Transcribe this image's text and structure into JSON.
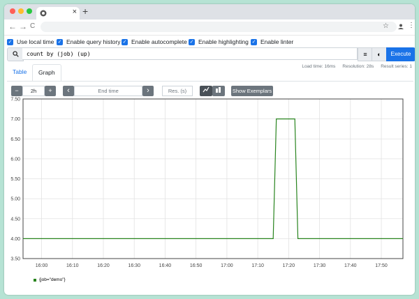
{
  "browser": {
    "tab_close": "×",
    "new_tab": "+",
    "back": "←",
    "forward": "→",
    "reload": "C",
    "star_icon": "☆",
    "menu_icon": "⋮"
  },
  "options": [
    {
      "label": "Use local time",
      "checked": true
    },
    {
      "label": "Enable query history",
      "checked": true
    },
    {
      "label": "Enable autocomplete",
      "checked": true
    },
    {
      "label": "Enable highlighting",
      "checked": true
    },
    {
      "label": "Enable linter",
      "checked": true
    }
  ],
  "query": {
    "text": "count by (job) (up)",
    "execute_label": "Execute"
  },
  "stats": {
    "load_time": "Load time: 16ms",
    "resolution": "Resolution: 28s",
    "result_series": "Result series: 1"
  },
  "tabs": {
    "table": "Table",
    "graph": "Graph"
  },
  "controls": {
    "minus": "−",
    "range": "2h",
    "plus": "+",
    "prev": "‹",
    "end_time_placeholder": "End time",
    "next": "›",
    "res_placeholder": "Res. (s)",
    "exemplars": "Show Exemplars"
  },
  "chart_data": {
    "type": "line",
    "x": [
      "15:54",
      "17:15",
      "17:16",
      "17:22",
      "17:23",
      "17:57"
    ],
    "x_ticks": [
      "16:00",
      "16:10",
      "16:20",
      "16:30",
      "16:40",
      "16:50",
      "17:00",
      "17:10",
      "17:20",
      "17:30",
      "17:40",
      "17:50"
    ],
    "y_ticks": [
      "3.50",
      "4.00",
      "4.50",
      "5.00",
      "5.50",
      "6.00",
      "6.50",
      "7.00",
      "7.50"
    ],
    "ylim": [
      3.5,
      7.5
    ],
    "grid": true,
    "series": [
      {
        "name": "{job=\"demo\"}",
        "color": "#28841e",
        "points": [
          [
            "15:54",
            4
          ],
          [
            "17:15",
            4
          ],
          [
            "17:16",
            7
          ],
          [
            "17:22",
            7
          ],
          [
            "17:23",
            4
          ],
          [
            "17:57",
            4
          ]
        ]
      }
    ]
  },
  "legend": {
    "label": "{job=\"demo\"}"
  }
}
